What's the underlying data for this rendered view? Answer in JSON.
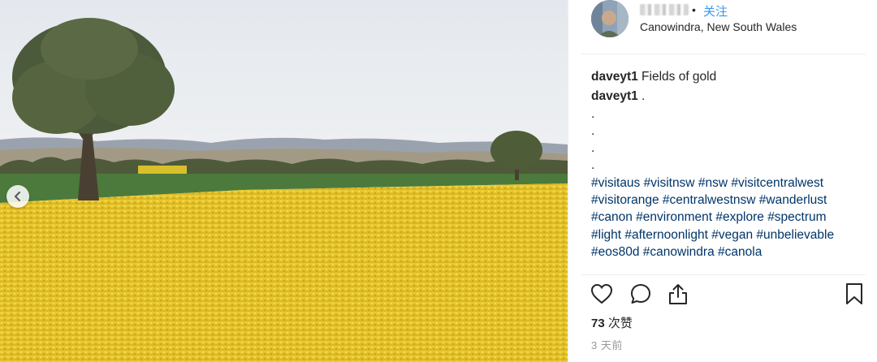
{
  "post": {
    "location": "Canowindra, New South Wales",
    "follow_label": "关注",
    "follow_separator": "•"
  },
  "caption": {
    "username": "daveyt1",
    "title_text": "Fields of gold",
    "comment_username": "daveyt1",
    "comment_text": ".",
    "dots": [
      ".",
      ".",
      ".",
      "."
    ],
    "hashtag_lines": [
      [
        "#visitaus",
        "#visitnsw",
        "#nsw",
        "#visitcentralwest"
      ],
      [
        "#visitorange",
        "#centralwestnsw",
        "#wanderlust"
      ],
      [
        "#canon",
        "#environment",
        "#explore",
        "#spectrum"
      ],
      [
        "#light",
        "#afternoonlight",
        "#vegan",
        "#unbelievable"
      ],
      [
        "#eos80d",
        "#canowindra",
        "#canola"
      ]
    ]
  },
  "stats": {
    "likes_count": "73",
    "likes_suffix": "次赞",
    "posted_ago": "3 天前"
  },
  "icons": {
    "prev": "chevron-left-icon",
    "like": "heart-icon",
    "comment": "comment-bubble-icon",
    "share": "share-icon",
    "save": "bookmark-icon"
  },
  "colors": {
    "link_blue": "#3897f0",
    "hashtag": "#003569",
    "field_yellow": "#e6c52a",
    "sky": "#e9ecf0"
  }
}
